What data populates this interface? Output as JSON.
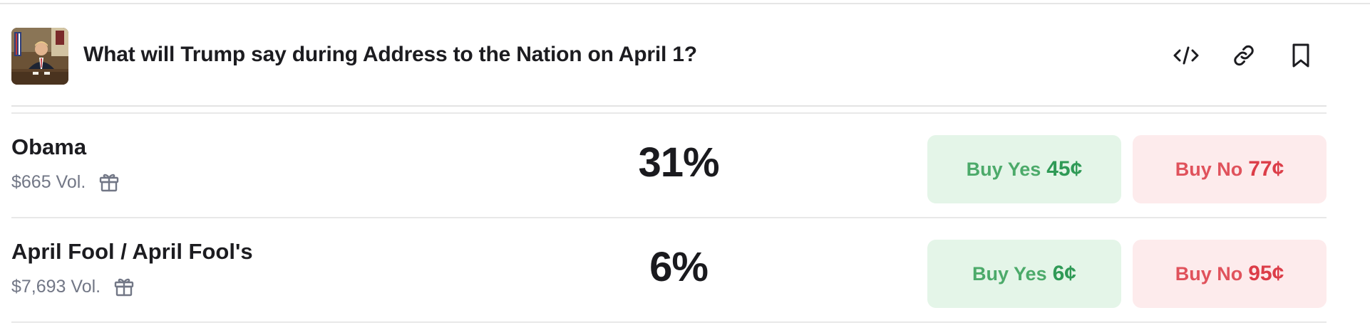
{
  "market": {
    "title": "What will Trump say during Address to the Nation on April 1?",
    "thumbnail_alt": "Trump seated at the Resolute desk in the Oval Office",
    "header_icons": [
      "embed-code-icon",
      "link-icon",
      "bookmark-icon"
    ]
  },
  "outcomes": [
    {
      "name": "Obama",
      "volume": "$665 Vol.",
      "chance": "31%",
      "buy_yes_label": "Buy Yes",
      "buy_yes_price": "45¢",
      "buy_no_label": "Buy No",
      "buy_no_price": "77¢"
    },
    {
      "name": "April Fool / April Fool's",
      "volume": "$7,693 Vol.",
      "chance": "6%",
      "buy_yes_label": "Buy Yes",
      "buy_yes_price": "6¢",
      "buy_no_label": "Buy No",
      "buy_no_price": "95¢"
    }
  ],
  "colors": {
    "yes_bg": "#e4f5e8",
    "yes_text": "#2f9a56",
    "no_bg": "#fdebec",
    "no_text": "#dc3d48",
    "muted_text": "#727786"
  }
}
